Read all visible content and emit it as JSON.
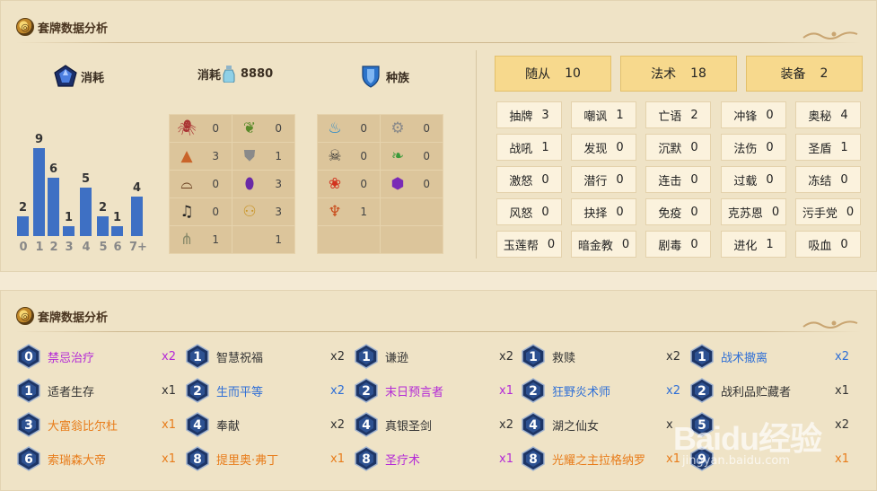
{
  "top_section": {
    "title": "套牌数据分析",
    "cost_label": "消耗",
    "dust_label": "消耗",
    "dust_value": "8880",
    "race_label": "种族"
  },
  "mana_curve": {
    "ticks": [
      "0",
      "1",
      "2",
      "3",
      "4",
      "5",
      "6",
      "7+"
    ],
    "values": [
      2,
      9,
      6,
      1,
      5,
      2,
      1,
      4
    ]
  },
  "class_grid": [
    {
      "icon": "spider-icon",
      "count": "0"
    },
    {
      "icon": "leaf-icon",
      "count": "0"
    },
    {
      "icon": "mountain-icon",
      "count": "3"
    },
    {
      "icon": "shield-icon",
      "count": "1"
    },
    {
      "icon": "hat-icon",
      "count": "0"
    },
    {
      "icon": "purple-gem-icon",
      "count": "3"
    },
    {
      "icon": "music-icon",
      "count": "0"
    },
    {
      "icon": "brass-knuckles-icon",
      "count": "3"
    },
    {
      "icon": "claw-icon",
      "count": "1"
    },
    {
      "icon": "",
      "count": "1"
    }
  ],
  "race_grid": [
    {
      "icon": "murloc-icon",
      "count": "0"
    },
    {
      "icon": "gear-icon",
      "count": "0"
    },
    {
      "icon": "pirate-icon",
      "count": "0"
    },
    {
      "icon": "dragon-icon",
      "count": "0"
    },
    {
      "icon": "paw-icon",
      "count": "0"
    },
    {
      "icon": "demon-icon",
      "count": "0"
    },
    {
      "icon": "totem-icon",
      "count": "1"
    },
    {
      "icon": "",
      "count": ""
    },
    {
      "icon": "",
      "count": ""
    },
    {
      "icon": "",
      "count": ""
    }
  ],
  "type_tags": [
    {
      "label": "随从",
      "count": "10"
    },
    {
      "label": "法术",
      "count": "18"
    },
    {
      "label": "装备",
      "count": "2"
    }
  ],
  "mechanics": [
    {
      "label": "抽牌",
      "count": "3"
    },
    {
      "label": "嘲讽",
      "count": "1"
    },
    {
      "label": "亡语",
      "count": "2"
    },
    {
      "label": "冲锋",
      "count": "0"
    },
    {
      "label": "奥秘",
      "count": "4"
    },
    {
      "label": "战吼",
      "count": "1"
    },
    {
      "label": "发现",
      "count": "0"
    },
    {
      "label": "沉默",
      "count": "0"
    },
    {
      "label": "法伤",
      "count": "0"
    },
    {
      "label": "圣盾",
      "count": "1"
    },
    {
      "label": "激怒",
      "count": "0"
    },
    {
      "label": "潜行",
      "count": "0"
    },
    {
      "label": "连击",
      "count": "0"
    },
    {
      "label": "过载",
      "count": "0"
    },
    {
      "label": "冻结",
      "count": "0"
    },
    {
      "label": "风怒",
      "count": "0"
    },
    {
      "label": "抉择",
      "count": "0"
    },
    {
      "label": "免疫",
      "count": "0"
    },
    {
      "label": "克苏恩",
      "count": "0"
    },
    {
      "label": "污手党",
      "count": "0"
    },
    {
      "label": "玉莲帮",
      "count": "0"
    },
    {
      "label": "暗金教",
      "count": "0"
    },
    {
      "label": "剧毒",
      "count": "0"
    },
    {
      "label": "进化",
      "count": "1"
    },
    {
      "label": "吸血",
      "count": "0"
    }
  ],
  "bottom_section": {
    "title": "套牌数据分析"
  },
  "cards": [
    {
      "cost": "0",
      "name": "禁忌治疗",
      "count": "x2",
      "rarity": "epic"
    },
    {
      "cost": "1",
      "name": "智慧祝福",
      "count": "x2",
      "rarity": "common"
    },
    {
      "cost": "1",
      "name": "谦逊",
      "count": "x2",
      "rarity": "common"
    },
    {
      "cost": "1",
      "name": "救赎",
      "count": "x2",
      "rarity": "common"
    },
    {
      "cost": "1",
      "name": "战术撤离",
      "count": "x2",
      "rarity": "rare"
    },
    {
      "cost": "1",
      "name": "适者生存",
      "count": "x1",
      "rarity": "common"
    },
    {
      "cost": "2",
      "name": "生而平等",
      "count": "x2",
      "rarity": "rare"
    },
    {
      "cost": "2",
      "name": "末日预言者",
      "count": "x1",
      "rarity": "epic"
    },
    {
      "cost": "2",
      "name": "狂野炎术师",
      "count": "x2",
      "rarity": "rare"
    },
    {
      "cost": "2",
      "name": "战利品贮藏者",
      "count": "x1",
      "rarity": "common"
    },
    {
      "cost": "3",
      "name": "大富翁比尔杜",
      "count": "x1",
      "rarity": "legend"
    },
    {
      "cost": "4",
      "name": "奉献",
      "count": "x2",
      "rarity": "common"
    },
    {
      "cost": "4",
      "name": "真银圣剑",
      "count": "x2",
      "rarity": "common"
    },
    {
      "cost": "4",
      "name": "湖之仙女",
      "count": "x",
      "rarity": "common"
    },
    {
      "cost": "5",
      "name": "",
      "count": "x2",
      "rarity": "common"
    },
    {
      "cost": "6",
      "name": "索瑞森大帝",
      "count": "x1",
      "rarity": "legend"
    },
    {
      "cost": "8",
      "name": "提里奥·弗丁",
      "count": "x1",
      "rarity": "legend"
    },
    {
      "cost": "8",
      "name": "圣疗术",
      "count": "x1",
      "rarity": "epic"
    },
    {
      "cost": "8",
      "name": "光耀之主拉格纳罗",
      "count": "x1",
      "rarity": "legend"
    },
    {
      "cost": "9",
      "name": "",
      "count": "x1",
      "rarity": "legend"
    }
  ],
  "colors": {
    "bar": "#3e70c4",
    "common": "#333333",
    "rare": "#2f6fd6",
    "epic": "#b42ad6",
    "legend": "#e87c1a",
    "tag": "#f7d98d"
  },
  "watermark": {
    "brand": "Baidu经验",
    "url": "jingyan.baidu.com"
  }
}
